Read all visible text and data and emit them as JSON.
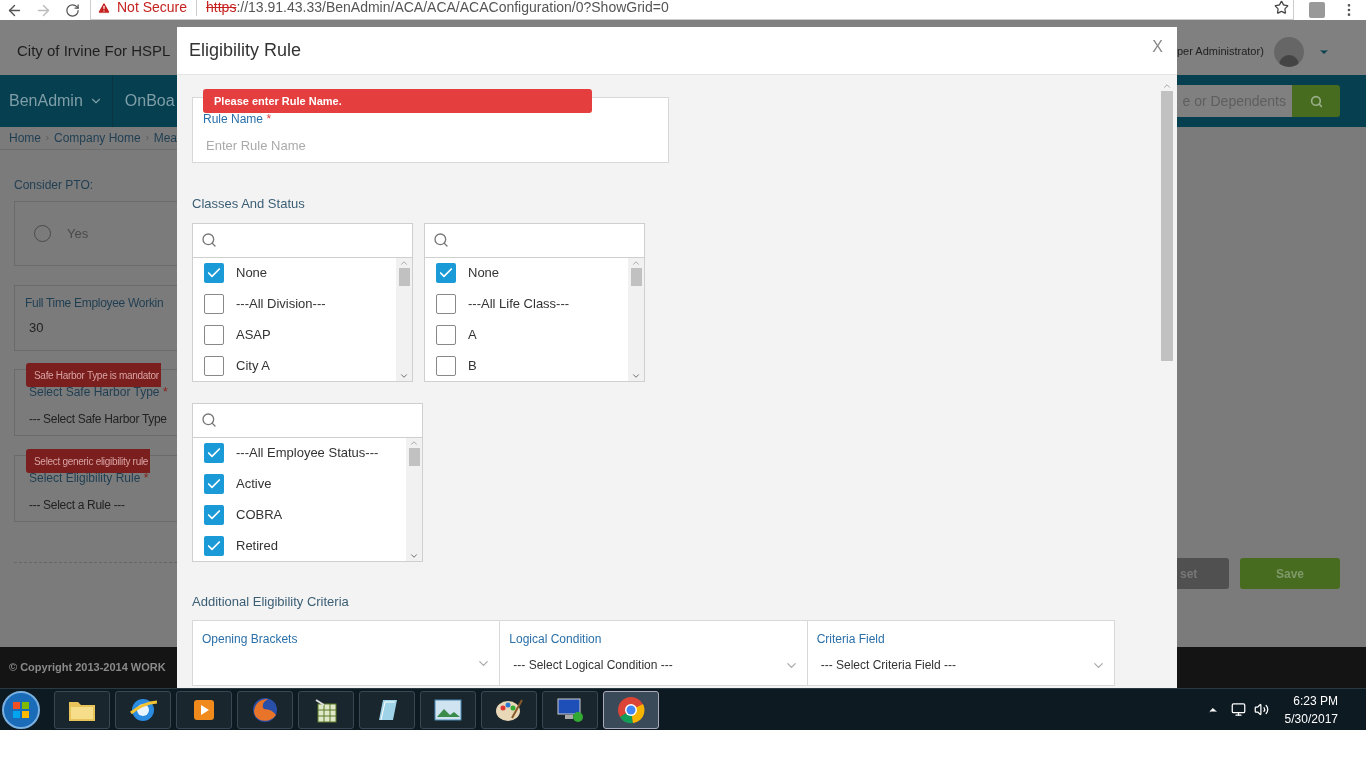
{
  "browser": {
    "security": "Not Secure",
    "url_scheme": "https",
    "url_rest": "://13.91.43.33/BenAdmin/ACA/ACA/ACAConfiguration/0?ShowGrid=0"
  },
  "background": {
    "company": "City of Irvine For HSPL",
    "user": "per Administrator)",
    "nav": [
      {
        "label": "BenAdmin",
        "dropdown": true
      },
      {
        "label": "OnBoa",
        "dropdown": false
      }
    ],
    "search_placeholder": "e or Dependents",
    "breadcrumbs": [
      "Home",
      "Company Home",
      "Mea"
    ],
    "consider_pto": {
      "label": "Consider PTO:",
      "option": "Yes",
      "selected": false
    },
    "full_time": {
      "label": "Full Time Employee Workin",
      "value": "30"
    },
    "selects": [
      {
        "error": "Safe Harbor Type is mandator",
        "label": "Select Safe Harbor Type",
        "required_mark": "*",
        "value": "--- Select Safe Harbor Type"
      },
      {
        "error": "Select generic eligibility rule",
        "label": "Select Eligibility Rule",
        "required_mark": "*",
        "value": "--- Select a Rule ---"
      }
    ],
    "buttons": [
      {
        "label": "set",
        "kind": "secondary"
      },
      {
        "label": "Save",
        "kind": "primary"
      }
    ],
    "footer": "© Copyright 2013-2014 WORK"
  },
  "modal": {
    "title": "Eligibility Rule",
    "close": "X",
    "rule_name": {
      "label": "Rule Name",
      "required_mark": "*",
      "placeholder": "Enter Rule Name",
      "error": "Please enter Rule Name."
    },
    "classes_title": "Classes And Status",
    "lists": [
      {
        "items": [
          {
            "label": "None",
            "checked": true
          },
          {
            "label": "---All Division---",
            "checked": false
          },
          {
            "label": "ASAP",
            "checked": false
          },
          {
            "label": "City A",
            "checked": false
          }
        ]
      },
      {
        "items": [
          {
            "label": "None",
            "checked": true
          },
          {
            "label": "---All Life Class---",
            "checked": false
          },
          {
            "label": "A",
            "checked": false
          },
          {
            "label": "B",
            "checked": false
          }
        ]
      },
      {
        "items": [
          {
            "label": "---All Employee Status---",
            "checked": true
          },
          {
            "label": "Active",
            "checked": true
          },
          {
            "label": "COBRA",
            "checked": true
          },
          {
            "label": "Retired",
            "checked": true
          }
        ]
      }
    ],
    "criteria_title": "Additional Eligibility Criteria",
    "criteria": [
      {
        "label": "Opening Brackets"
      },
      {
        "label": "Logical Condition",
        "value": "--- Select Logical Condition ---"
      },
      {
        "label": "Criteria Field",
        "value": "--- Select Criteria Field ---"
      }
    ]
  },
  "taskbar": {
    "apps": [
      {
        "kind": "folder",
        "selected": false
      },
      {
        "kind": "globe",
        "selected": false
      },
      {
        "kind": "media",
        "selected": false
      },
      {
        "kind": "fox",
        "selected": false
      },
      {
        "kind": "sheet",
        "selected": false
      },
      {
        "kind": "notepad",
        "selected": false
      },
      {
        "kind": "photo",
        "selected": false
      },
      {
        "kind": "palette",
        "selected": false
      },
      {
        "kind": "remote",
        "selected": false
      },
      {
        "kind": "chrome",
        "selected": true
      }
    ],
    "time": "6:23 PM",
    "date": "5/30/2017"
  }
}
